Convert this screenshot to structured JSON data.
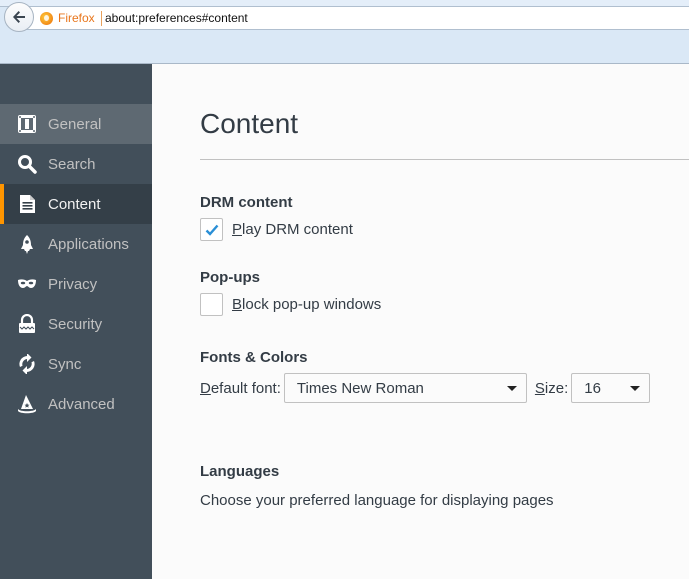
{
  "browser": {
    "identity_label": "Firefox",
    "url": "about:preferences#content"
  },
  "sidebar": {
    "items": [
      {
        "label": "General",
        "icon": "general-icon",
        "state": "hover"
      },
      {
        "label": "Search",
        "icon": "search-icon",
        "state": "normal"
      },
      {
        "label": "Content",
        "icon": "content-icon",
        "state": "selected"
      },
      {
        "label": "Applications",
        "icon": "applications-icon",
        "state": "normal"
      },
      {
        "label": "Privacy",
        "icon": "privacy-mask-icon",
        "state": "normal"
      },
      {
        "label": "Security",
        "icon": "security-lock-icon",
        "state": "normal"
      },
      {
        "label": "Sync",
        "icon": "sync-icon",
        "state": "normal"
      },
      {
        "label": "Advanced",
        "icon": "advanced-wizard-hat-icon",
        "state": "normal"
      }
    ],
    "accent_color": "#ff9500"
  },
  "main": {
    "title": "Content",
    "drm": {
      "heading": "DRM content",
      "checkbox_label_accesskey": "P",
      "checkbox_label_rest": "lay DRM content",
      "checked": true
    },
    "popups": {
      "heading": "Pop-ups",
      "checkbox_label_accesskey": "B",
      "checkbox_label_rest": "lock pop-up windows",
      "checked": false
    },
    "fonts": {
      "heading": "Fonts & Colors",
      "default_font_label_accesskey": "D",
      "default_font_label_rest": "efault font:",
      "default_font_value": "Times New Roman",
      "size_label_accesskey": "S",
      "size_label_rest": "ize:",
      "size_value": "16"
    },
    "languages": {
      "heading": "Languages",
      "description": "Choose your preferred language for displaying pages"
    }
  }
}
